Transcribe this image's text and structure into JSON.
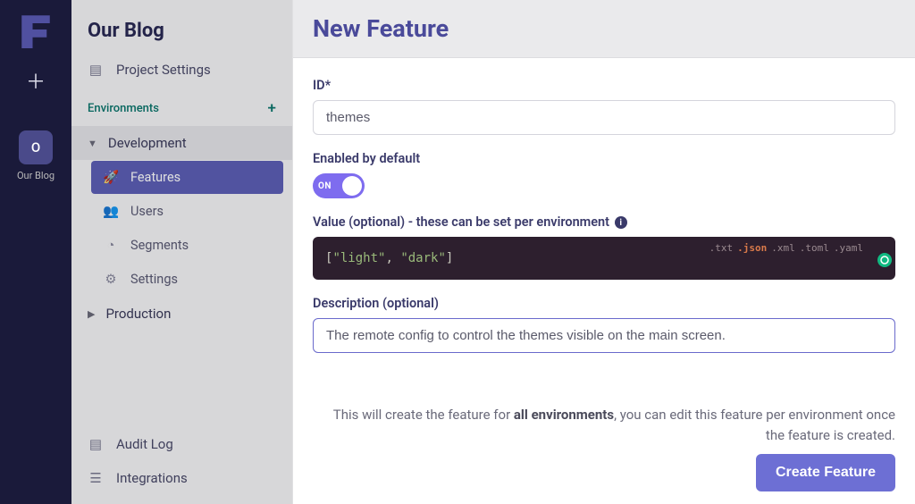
{
  "rail": {
    "project_initial": "O",
    "project_label": "Our Blog"
  },
  "sidebar": {
    "title": "Our Blog",
    "project_settings": "Project Settings",
    "environments_label": "Environments",
    "env_dev": "Development",
    "env_prod": "Production",
    "nav": {
      "features": "Features",
      "users": "Users",
      "segments": "Segments",
      "settings": "Settings"
    },
    "footer": {
      "audit_log": "Audit Log",
      "integrations": "Integrations"
    }
  },
  "form": {
    "heading": "New Feature",
    "id_label": "ID*",
    "id_value": "themes",
    "enabled_label": "Enabled by default",
    "toggle_state": "ON",
    "value_label": "Value (optional) - these can be set per environment",
    "code_value_display": "[\"light\", \"dark\"]",
    "code_ext": {
      "txt": ".txt",
      "json": ".json",
      "xml": ".xml",
      "toml": ".toml",
      "yaml": ".yaml"
    },
    "desc_label": "Description (optional)",
    "desc_value": "The remote config to control the themes visible on the main screen.",
    "helper_pre": "This will create the feature for ",
    "helper_bold": "all environments",
    "helper_post": ", you can edit this feature per environment once the feature is created.",
    "create_btn": "Create Feature"
  }
}
